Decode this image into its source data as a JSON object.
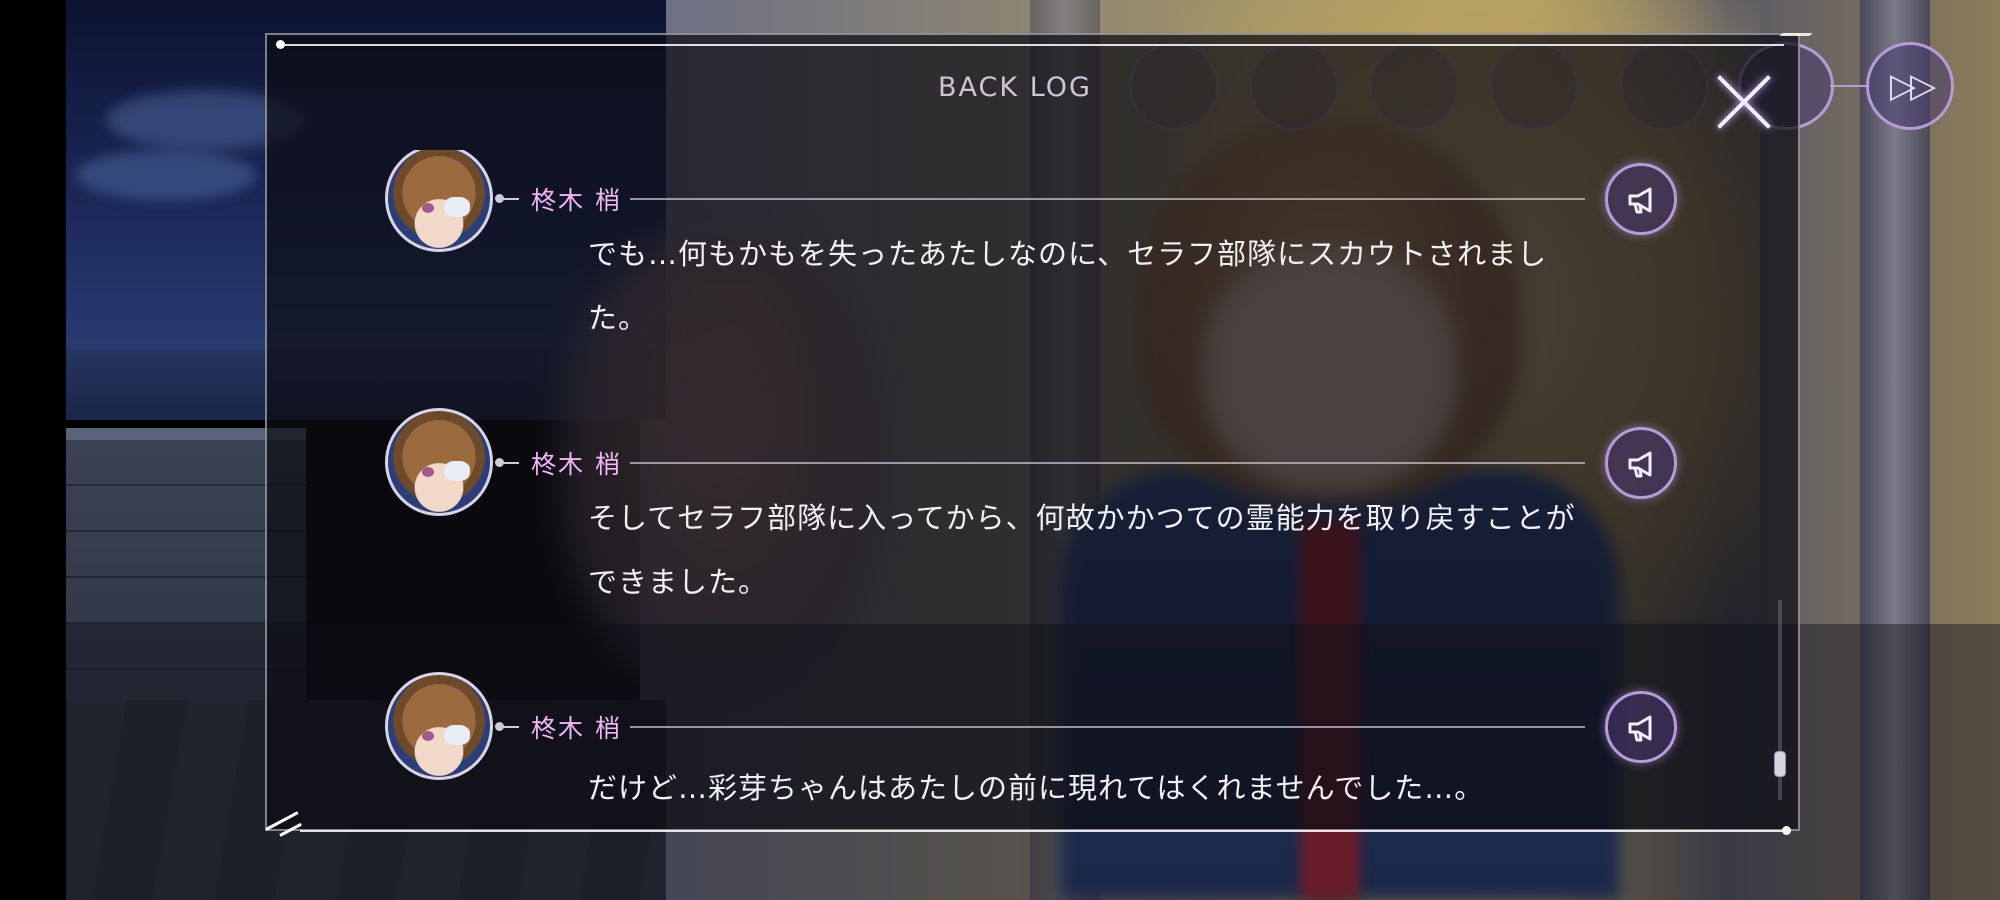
{
  "panel": {
    "title": "BACK LOG"
  },
  "controls": {
    "fast_forward_label": "▷▷"
  },
  "entries": [
    {
      "speaker": "柊木 梢",
      "text": "でも…何もかもを失ったあたしなのに、セラフ部隊にスカウトされました。"
    },
    {
      "speaker": "柊木 梢",
      "text": "そしてセラフ部隊に入ってから、何故かかつての霊能力を取り戻すことができました。"
    },
    {
      "speaker": "柊木 梢",
      "text": "だけど…彩芽ちゃんはあたしの前に現れてはくれませんでした…。"
    }
  ],
  "icons": {
    "close": "close-icon",
    "voice": "megaphone-icon",
    "fast_forward": "fast-forward-icon"
  },
  "colors": {
    "speaker_name": "#f1b6f6",
    "accent": "#b79ad8",
    "text": "#f2f0f4"
  }
}
